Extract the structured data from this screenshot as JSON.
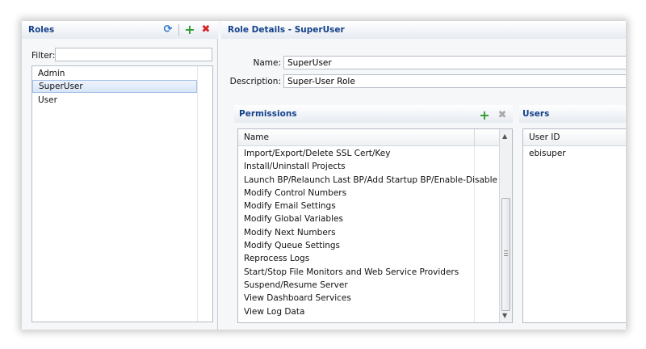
{
  "roles_panel": {
    "title": "Roles",
    "icons": {
      "refresh": "refresh-icon",
      "add": "add-icon",
      "delete": "delete-icon"
    },
    "filter_label": "Filter:",
    "filter_value": "",
    "items": [
      "Admin",
      "SuperUser",
      "User"
    ],
    "selected": "SuperUser"
  },
  "details": {
    "title": "Role Details - SuperUser",
    "name_label": "Name:",
    "name_value": "SuperUser",
    "description_label": "Description:",
    "description_value": "Super-User Role"
  },
  "permissions": {
    "title": "Permissions",
    "column": "Name",
    "rows": [
      "Import/Export/Delete SSL Cert/Key",
      "Install/Uninstall Projects",
      "Launch BP/Relaunch Last BP/Add Startup BP/Enable-Disable ...",
      "Modify Control Numbers",
      "Modify Email Settings",
      "Modify Global Variables",
      "Modify Next Numbers",
      "Modify Queue Settings",
      "Reprocess Logs",
      "Start/Stop File Monitors and Web Service Providers",
      "Suspend/Resume Server",
      "View Dashboard Services",
      "View Log Data"
    ]
  },
  "users": {
    "title": "Users",
    "column": "User ID",
    "rows": [
      "ebisuper"
    ]
  },
  "colors": {
    "header_text": "#15428b",
    "add": "#2f9a2f",
    "delete": "#d52222",
    "refresh": "#2f77c8"
  }
}
